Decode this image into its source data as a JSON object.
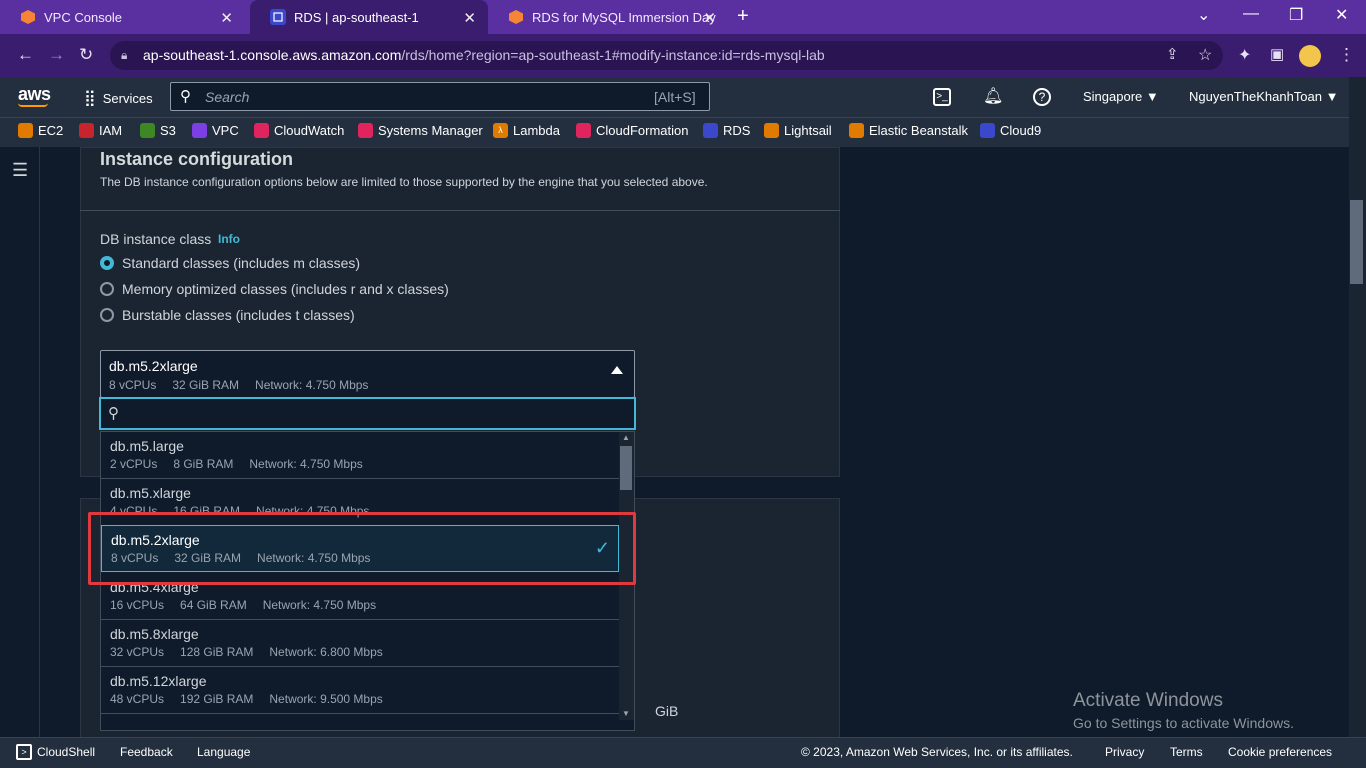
{
  "browser": {
    "tabs": [
      {
        "title": "VPC Console"
      },
      {
        "title": "RDS | ap-southeast-1"
      },
      {
        "title": "RDS for MySQL Immersion Day"
      }
    ],
    "url_host": "ap-southeast-1.console.aws.amazon.com",
    "url_path": "/rds/home?region=ap-southeast-1#modify-instance:id=rds-mysql-lab"
  },
  "aws_header": {
    "logo": "aws",
    "services_label": "Services",
    "search_placeholder": "Search",
    "search_shortcut": "[Alt+S]",
    "region": "Singapore",
    "user": "NguyenTheKhanhToan"
  },
  "favorites": [
    {
      "label": "EC2",
      "color": "#e07b00"
    },
    {
      "label": "IAM",
      "color": "#c7242b"
    },
    {
      "label": "S3",
      "color": "#3f8624"
    },
    {
      "label": "VPC",
      "color": "#7b3fe4"
    },
    {
      "label": "CloudWatch",
      "color": "#e0245e"
    },
    {
      "label": "Systems Manager",
      "color": "#e0245e"
    },
    {
      "label": "Lambda",
      "color": "#e07b00"
    },
    {
      "label": "CloudFormation",
      "color": "#e0245e"
    },
    {
      "label": "RDS",
      "color": "#3b48cc"
    },
    {
      "label": "Lightsail",
      "color": "#e07b00"
    },
    {
      "label": "Elastic Beanstalk",
      "color": "#e07b00"
    },
    {
      "label": "Cloud9",
      "color": "#3b48cc"
    }
  ],
  "section": {
    "title": "Instance configuration",
    "description": "The DB instance configuration options below are limited to those supported by the engine that you selected above.",
    "class_label": "DB instance class",
    "info_link": "Info",
    "radios": [
      {
        "label": "Standard classes (includes m classes)",
        "checked": true
      },
      {
        "label": "Memory optimized classes (includes r and x classes)",
        "checked": false
      },
      {
        "label": "Burstable classes (includes t classes)",
        "checked": false
      }
    ],
    "selected": {
      "name": "db.m5.2xlarge",
      "vcpu": "8 vCPUs",
      "ram": "32 GiB RAM",
      "network": "Network: 4.750 Mbps"
    },
    "options": [
      {
        "name": "db.m5.large",
        "vcpu": "2 vCPUs",
        "ram": "8 GiB RAM",
        "network": "Network: 4.750 Mbps"
      },
      {
        "name": "db.m5.xlarge",
        "vcpu": "4 vCPUs",
        "ram": "16 GiB RAM",
        "network": "Network: 4.750 Mbps"
      },
      {
        "name": "db.m5.2xlarge",
        "vcpu": "8 vCPUs",
        "ram": "32 GiB RAM",
        "network": "Network: 4.750 Mbps"
      },
      {
        "name": "db.m5.4xlarge",
        "vcpu": "16 vCPUs",
        "ram": "64 GiB RAM",
        "network": "Network: 4.750 Mbps"
      },
      {
        "name": "db.m5.8xlarge",
        "vcpu": "32 vCPUs",
        "ram": "128 GiB RAM",
        "network": "Network: 6.800 Mbps"
      },
      {
        "name": "db.m5.12xlarge",
        "vcpu": "48 vCPUs",
        "ram": "192 GiB RAM",
        "network": "Network: 9.500 Mbps"
      }
    ],
    "storage_unit": "GiB"
  },
  "watermark": {
    "line1": "Activate Windows",
    "line2": "Go to Settings to activate Windows."
  },
  "footer": {
    "cloudshell": "CloudShell",
    "feedback": "Feedback",
    "language": "Language",
    "copyright": "© 2023, Amazon Web Services, Inc. or its affiliates.",
    "privacy": "Privacy",
    "terms": "Terms",
    "cookies": "Cookie preferences"
  },
  "colors": {
    "accent": "#44b9d6",
    "highlight": "#e0393e",
    "brand": "#ff9900"
  }
}
